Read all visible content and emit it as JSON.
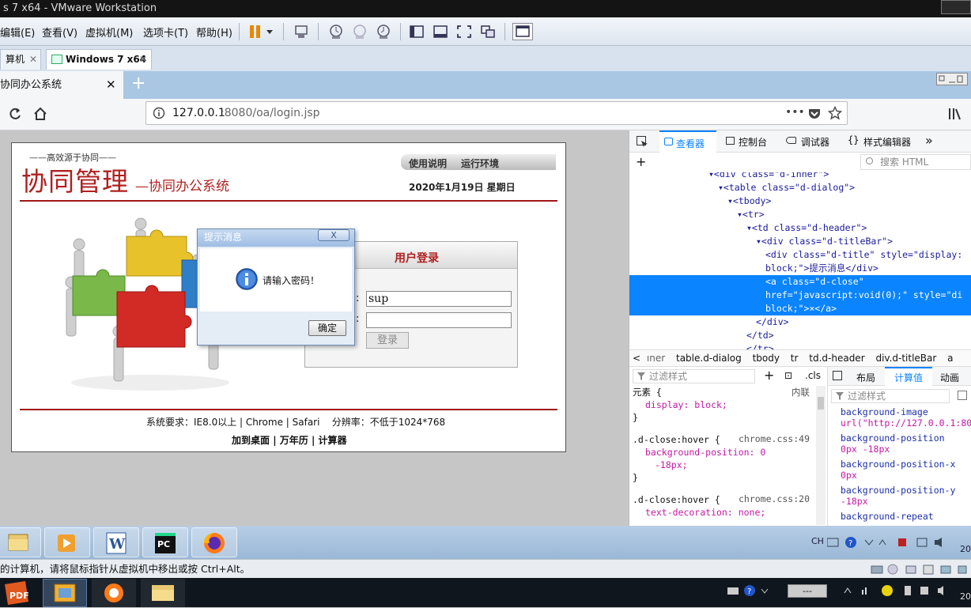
{
  "vmware": {
    "title": "s 7 x64 - VMware Workstation",
    "menu": [
      "编辑(E)",
      "查看(V)",
      "虚拟机(M)",
      "选项卡(T)",
      "帮助(H)"
    ],
    "tabs": [
      {
        "label": "算机"
      },
      {
        "label": "Windows 7 x64"
      }
    ],
    "status": "的计算机，请将鼠标指针从虚拟机中移出或按 Ctrl+Alt。"
  },
  "firefox": {
    "tab_title": "协同办公系统",
    "new_tab": "+",
    "url_host": "127.0.0.1",
    "url_rest": ":8080/oa/login.jsp",
    "url_dots": "•••"
  },
  "page": {
    "slogan": "——高效源于协同——",
    "logo_main": "协同管理",
    "logo_sub": "—协同办公系统",
    "links": [
      "使用说明",
      "运行环境"
    ],
    "date": "2020年1月19日 星期日",
    "login_title": "用户登录",
    "username_value": "sup",
    "password_value": "",
    "login_button": "登录",
    "sys_req": "系统要求：IE8.0以上 | Chrome | Safari    分辨率：不低于1024*768",
    "footer_links": [
      "加到桌面",
      "万年历",
      "计算器"
    ],
    "colon": ":"
  },
  "dialog": {
    "title": "提示消息",
    "close": "X",
    "message": "请输入密码！",
    "ok": "确定"
  },
  "devtools": {
    "tabs": [
      "查看器",
      "控制台",
      "调试器",
      "样式编辑器"
    ],
    "more": "»",
    "search_placeholder": "搜索 HTML",
    "html_lines": [
      {
        "indent": 0,
        "text": "▾<div class=\"d-inner\">"
      },
      {
        "indent": 1,
        "text": "▾<table class=\"d-dialog\">"
      },
      {
        "indent": 2,
        "text": "▾<tbody>"
      },
      {
        "indent": 3,
        "text": "▾<tr>"
      },
      {
        "indent": 4,
        "text": "▾<td class=\"d-header\">"
      },
      {
        "indent": 5,
        "text": "▾<div class=\"d-titleBar\">"
      },
      {
        "indent": 6,
        "text": "<div class=\"d-title\" style=\"display:"
      },
      {
        "indent": 6,
        "text": "block;\">提示消息</div>"
      },
      {
        "indent": 6,
        "text": "<a class=\"d-close\"",
        "selected": true
      },
      {
        "indent": 6,
        "text": "href=\"javascript:void(0);\" style=\"di",
        "selected": true
      },
      {
        "indent": 6,
        "text": "block;\">×</a>",
        "selected": true
      },
      {
        "indent": 5,
        "text": "</div>"
      },
      {
        "indent": 4,
        "text": "</td>"
      },
      {
        "indent": 4,
        "text": "</tr>"
      }
    ],
    "breadcrumb": [
      "ıner",
      "table.d-dialog",
      "tbody",
      "tr",
      "td.d-header",
      "div.d-titleBar",
      "a"
    ],
    "filter_placeholder": "过滤样式",
    "cls": ".cls",
    "right_tabs": [
      "布局",
      "计算值",
      "动画"
    ],
    "right_filter": "过滤样式",
    "rules": [
      {
        "selector": "元素 {",
        "source": "内联",
        "decls": [
          "display: block;"
        ],
        "close": "}"
      },
      {
        "selector": ".d-close:hover {",
        "source": "chrome.css:49",
        "decls": [
          "background-position: 0",
          "-18px;"
        ],
        "close": "}"
      },
      {
        "selector": ".d-close:hover {",
        "source": "chrome.css:20",
        "decls": [
          "text-decoration: none;"
        ],
        "close": ""
      }
    ],
    "computed": [
      {
        "name": "background-image",
        "value": "url(\"http://127.0.0.1:80"
      },
      {
        "name": "background-position",
        "value": "0px -18px"
      },
      {
        "name": "background-position-x",
        "value": "0px"
      },
      {
        "name": "background-position-y",
        "value": "-18px"
      },
      {
        "name": "background-repeat",
        "value": ""
      }
    ]
  },
  "taskbar": {
    "lang": "CH",
    "time_fragment": "20",
    "host_time": "20",
    "host_status": "---"
  }
}
